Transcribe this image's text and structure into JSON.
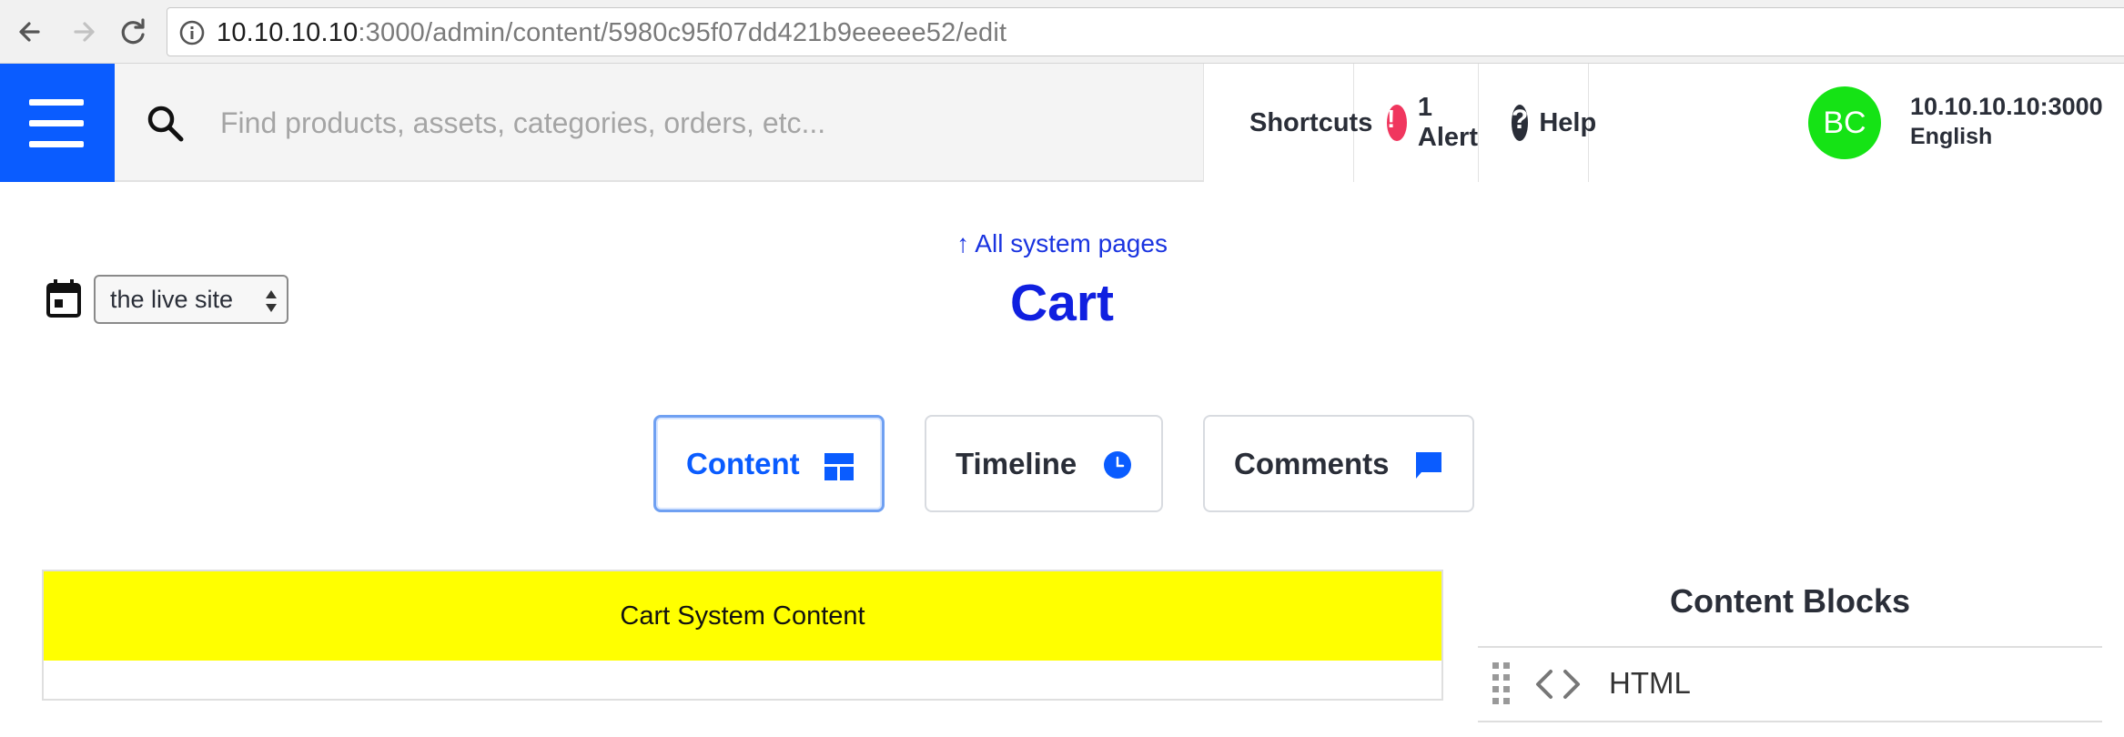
{
  "browser": {
    "url_host": "10.10.10.10",
    "url_rest": ":3000/admin/content/5980c95f07dd421b9eeeee52/edit"
  },
  "header": {
    "search_placeholder": "Find products, assets, categories, orders, etc...",
    "shortcuts_label": "Shortcuts",
    "alert_label": "1 Alert",
    "alert_icon_glyph": "!",
    "help_label": "Help",
    "help_icon_glyph": "?",
    "avatar_initials": "BC",
    "user_host": "10.10.10.10:3000",
    "user_language": "English",
    "colors": {
      "menu": "#0a5cff",
      "avatar": "#15e315",
      "alert": "#f0365e",
      "link_icon": "#1aa35a"
    }
  },
  "page": {
    "back_link": "↑ All system pages",
    "title": "Cart",
    "site_select_value": "the live site",
    "tabs": [
      {
        "label": "Content",
        "icon": "layout-icon",
        "active": true
      },
      {
        "label": "Timeline",
        "icon": "clock-icon",
        "active": false
      },
      {
        "label": "Comments",
        "icon": "comment-icon",
        "active": false
      }
    ]
  },
  "content": {
    "block_text": "Cart System Content",
    "block_color": "#ffff00"
  },
  "sidebar": {
    "title": "Content Blocks",
    "items": [
      {
        "label": "HTML",
        "icon": "code-icon"
      }
    ]
  }
}
